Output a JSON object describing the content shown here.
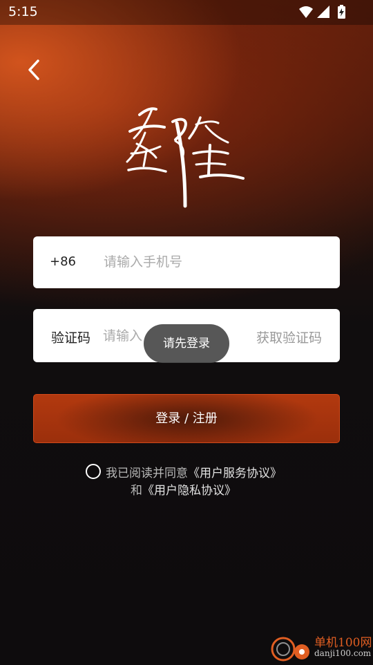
{
  "status_bar": {
    "time": "5:15",
    "icons": [
      "wifi-icon",
      "signal-icon",
      "battery-charging-icon"
    ]
  },
  "nav": {
    "back_icon": "chevron-left-icon"
  },
  "hero": {
    "title": "登陆"
  },
  "phone_card": {
    "country_code": "+86",
    "placeholder": "请输入手机号",
    "value": ""
  },
  "code_card": {
    "label": "验证码",
    "placeholder": "请输入",
    "value": "",
    "get_code_label": "获取验证码"
  },
  "toast": {
    "message": "请先登录"
  },
  "login_button": {
    "label": "登录 / 注册"
  },
  "agreement": {
    "checked": false,
    "prefix": "我已阅读并同意",
    "user_agreement": "《用户服务协议》",
    "and": "和",
    "privacy_policy": "《用户隐私协议》"
  },
  "watermark": {
    "title": "单机100网",
    "url": "danji100.com"
  },
  "colors": {
    "accent": "#b2390f",
    "accent_border": "#d2491a",
    "background": "#0e0c0d",
    "watermark": "#e05e22"
  }
}
